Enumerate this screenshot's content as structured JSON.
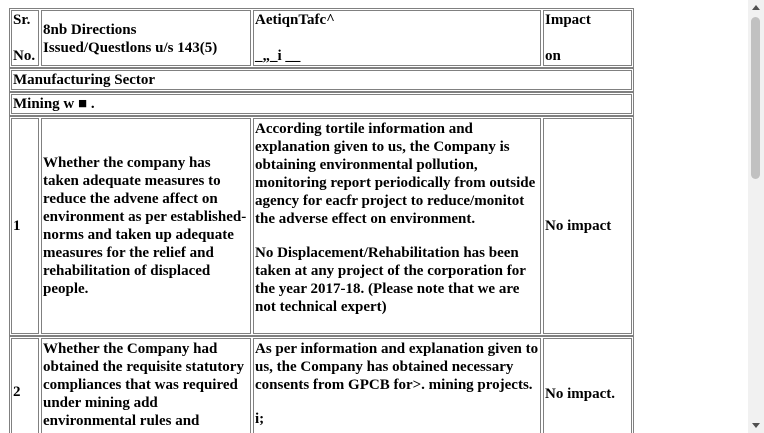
{
  "header": {
    "sr_line1": "Sr.",
    "sr_line2": "No.",
    "directions_line1": "8nb Directions",
    "directions_line2": "Issued/Questlons u/s 143(5)",
    "action_line1": "AetiqnTafc^",
    "action_line2": "_„_i __",
    "impact_line1": "Impact",
    "impact_line2": "on"
  },
  "sections": [
    {
      "label": "Manufacturing Sector"
    },
    {
      "label": "Mining w ■ ."
    }
  ],
  "rows": [
    {
      "sr": "1",
      "direction": "Whether the company has taken adequate measures to reduce the advene affect on environment as per established-norms and taken up adequate measures for the relief and rehabilitation of displaced people.",
      "action_para1": "According tortile information and explanation given to us, the Company is obtaining environmental pollution, monitoring report periodically from outside agency for eacfr project to reduce/monitot the adverse effect on environment.",
      "action_para2": "No Displacement/Rehabilitation has been taken at any project of the corporation for the year 2017-18. (Please note that we are not technical expert)",
      "impact": "No impact"
    },
    {
      "sr": "2",
      "direction": "Whether the Company had obtained the requisite statutory compliances that was required under mining add environmental rules and",
      "action_para1": "As per information and explanation given to us, the Company has obtained necessary consents from GPCB for>. mining projects.",
      "action_para2": "i;",
      "impact": "No impact."
    }
  ],
  "scrollbar": {
    "up_icon": "arrow-up-icon",
    "down_icon": "arrow-down-icon",
    "thumb_color": "#c1c1c1",
    "track_color": "#f1f1f1"
  }
}
